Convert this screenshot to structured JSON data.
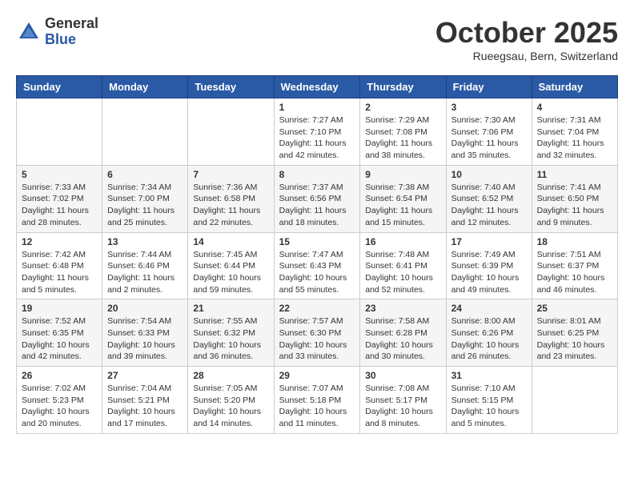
{
  "header": {
    "logo_general": "General",
    "logo_blue": "Blue",
    "month_title": "October 2025",
    "location": "Rueegsau, Bern, Switzerland"
  },
  "weekdays": [
    "Sunday",
    "Monday",
    "Tuesday",
    "Wednesday",
    "Thursday",
    "Friday",
    "Saturday"
  ],
  "weeks": [
    [
      {
        "day": "",
        "info": ""
      },
      {
        "day": "",
        "info": ""
      },
      {
        "day": "",
        "info": ""
      },
      {
        "day": "1",
        "info": "Sunrise: 7:27 AM\nSunset: 7:10 PM\nDaylight: 11 hours\nand 42 minutes."
      },
      {
        "day": "2",
        "info": "Sunrise: 7:29 AM\nSunset: 7:08 PM\nDaylight: 11 hours\nand 38 minutes."
      },
      {
        "day": "3",
        "info": "Sunrise: 7:30 AM\nSunset: 7:06 PM\nDaylight: 11 hours\nand 35 minutes."
      },
      {
        "day": "4",
        "info": "Sunrise: 7:31 AM\nSunset: 7:04 PM\nDaylight: 11 hours\nand 32 minutes."
      }
    ],
    [
      {
        "day": "5",
        "info": "Sunrise: 7:33 AM\nSunset: 7:02 PM\nDaylight: 11 hours\nand 28 minutes."
      },
      {
        "day": "6",
        "info": "Sunrise: 7:34 AM\nSunset: 7:00 PM\nDaylight: 11 hours\nand 25 minutes."
      },
      {
        "day": "7",
        "info": "Sunrise: 7:36 AM\nSunset: 6:58 PM\nDaylight: 11 hours\nand 22 minutes."
      },
      {
        "day": "8",
        "info": "Sunrise: 7:37 AM\nSunset: 6:56 PM\nDaylight: 11 hours\nand 18 minutes."
      },
      {
        "day": "9",
        "info": "Sunrise: 7:38 AM\nSunset: 6:54 PM\nDaylight: 11 hours\nand 15 minutes."
      },
      {
        "day": "10",
        "info": "Sunrise: 7:40 AM\nSunset: 6:52 PM\nDaylight: 11 hours\nand 12 minutes."
      },
      {
        "day": "11",
        "info": "Sunrise: 7:41 AM\nSunset: 6:50 PM\nDaylight: 11 hours\nand 9 minutes."
      }
    ],
    [
      {
        "day": "12",
        "info": "Sunrise: 7:42 AM\nSunset: 6:48 PM\nDaylight: 11 hours\nand 5 minutes."
      },
      {
        "day": "13",
        "info": "Sunrise: 7:44 AM\nSunset: 6:46 PM\nDaylight: 11 hours\nand 2 minutes."
      },
      {
        "day": "14",
        "info": "Sunrise: 7:45 AM\nSunset: 6:44 PM\nDaylight: 10 hours\nand 59 minutes."
      },
      {
        "day": "15",
        "info": "Sunrise: 7:47 AM\nSunset: 6:43 PM\nDaylight: 10 hours\nand 55 minutes."
      },
      {
        "day": "16",
        "info": "Sunrise: 7:48 AM\nSunset: 6:41 PM\nDaylight: 10 hours\nand 52 minutes."
      },
      {
        "day": "17",
        "info": "Sunrise: 7:49 AM\nSunset: 6:39 PM\nDaylight: 10 hours\nand 49 minutes."
      },
      {
        "day": "18",
        "info": "Sunrise: 7:51 AM\nSunset: 6:37 PM\nDaylight: 10 hours\nand 46 minutes."
      }
    ],
    [
      {
        "day": "19",
        "info": "Sunrise: 7:52 AM\nSunset: 6:35 PM\nDaylight: 10 hours\nand 42 minutes."
      },
      {
        "day": "20",
        "info": "Sunrise: 7:54 AM\nSunset: 6:33 PM\nDaylight: 10 hours\nand 39 minutes."
      },
      {
        "day": "21",
        "info": "Sunrise: 7:55 AM\nSunset: 6:32 PM\nDaylight: 10 hours\nand 36 minutes."
      },
      {
        "day": "22",
        "info": "Sunrise: 7:57 AM\nSunset: 6:30 PM\nDaylight: 10 hours\nand 33 minutes."
      },
      {
        "day": "23",
        "info": "Sunrise: 7:58 AM\nSunset: 6:28 PM\nDaylight: 10 hours\nand 30 minutes."
      },
      {
        "day": "24",
        "info": "Sunrise: 8:00 AM\nSunset: 6:26 PM\nDaylight: 10 hours\nand 26 minutes."
      },
      {
        "day": "25",
        "info": "Sunrise: 8:01 AM\nSunset: 6:25 PM\nDaylight: 10 hours\nand 23 minutes."
      }
    ],
    [
      {
        "day": "26",
        "info": "Sunrise: 7:02 AM\nSunset: 5:23 PM\nDaylight: 10 hours\nand 20 minutes."
      },
      {
        "day": "27",
        "info": "Sunrise: 7:04 AM\nSunset: 5:21 PM\nDaylight: 10 hours\nand 17 minutes."
      },
      {
        "day": "28",
        "info": "Sunrise: 7:05 AM\nSunset: 5:20 PM\nDaylight: 10 hours\nand 14 minutes."
      },
      {
        "day": "29",
        "info": "Sunrise: 7:07 AM\nSunset: 5:18 PM\nDaylight: 10 hours\nand 11 minutes."
      },
      {
        "day": "30",
        "info": "Sunrise: 7:08 AM\nSunset: 5:17 PM\nDaylight: 10 hours\nand 8 minutes."
      },
      {
        "day": "31",
        "info": "Sunrise: 7:10 AM\nSunset: 5:15 PM\nDaylight: 10 hours\nand 5 minutes."
      },
      {
        "day": "",
        "info": ""
      }
    ]
  ]
}
